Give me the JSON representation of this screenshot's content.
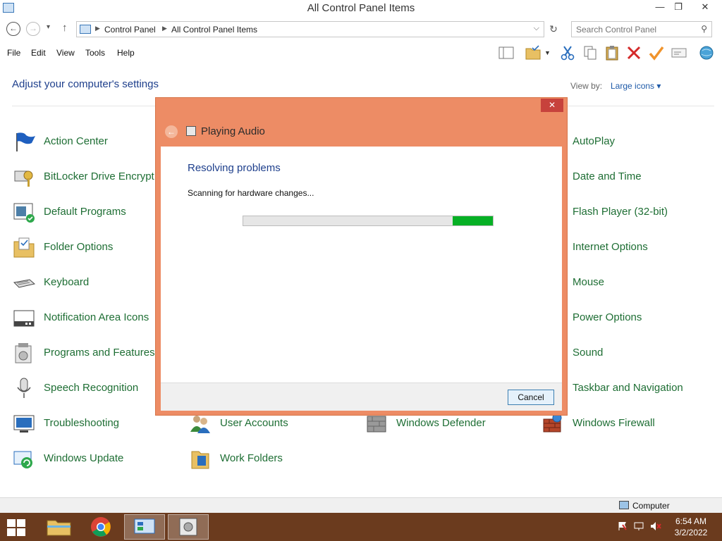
{
  "window": {
    "title": "All Control Panel Items",
    "minimize": "—",
    "maximize": "❐",
    "close": "✕"
  },
  "nav": {
    "back": "←",
    "forward": "→",
    "recent": "▾",
    "up": "↑",
    "breadcrumbs": [
      "Control Panel",
      "All Control Panel Items"
    ],
    "separator": "▶",
    "address_dropdown": "⌵",
    "refresh": "↻",
    "search_placeholder": "Search Control Panel",
    "search_icon": "⚲"
  },
  "menu": [
    "File",
    "Edit",
    "View",
    "Tools",
    "Help"
  ],
  "toolbar_icons": [
    "layout-icon",
    "folder-options-icon",
    "cut-icon",
    "copy-icon",
    "paste-icon",
    "delete-icon",
    "check-icon",
    "properties-icon",
    "globe-icon"
  ],
  "content": {
    "heading": "Adjust your computer's settings",
    "view_by_label": "View by:",
    "view_by_value": "Large icons ▾"
  },
  "items": [
    {
      "label": "Action Center",
      "icon": "flag-icon"
    },
    {
      "label": "BitLocker Drive Encrypt",
      "icon": "bitlocker-icon"
    },
    {
      "label": "Default Programs",
      "icon": "default-programs-icon"
    },
    {
      "label": "Folder Options",
      "icon": "folder-options-icon"
    },
    {
      "label": "Keyboard",
      "icon": "keyboard-icon"
    },
    {
      "label": "Notification Area Icons",
      "icon": "notification-icon"
    },
    {
      "label": "Programs and Features",
      "icon": "programs-icon"
    },
    {
      "label": "Speech Recognition",
      "icon": "microphone-icon"
    },
    {
      "label": "Troubleshooting",
      "icon": "troubleshooting-icon"
    },
    {
      "label": "Windows Update",
      "icon": "windows-update-icon"
    },
    {
      "label": "User Accounts",
      "icon": "users-icon"
    },
    {
      "label": "Work Folders",
      "icon": "work-folders-icon"
    },
    {
      "label": "Windows Defender",
      "icon": "defender-icon"
    },
    {
      "label": "AutoPlay",
      "icon": "autoplay-icon"
    },
    {
      "label": "Date and Time",
      "icon": "clock-icon"
    },
    {
      "label": "Flash Player (32-bit)",
      "icon": "flash-icon"
    },
    {
      "label": "Internet Options",
      "icon": "internet-icon"
    },
    {
      "label": "Mouse",
      "icon": "mouse-icon"
    },
    {
      "label": "Power Options",
      "icon": "power-icon"
    },
    {
      "label": "Sound",
      "icon": "sound-icon"
    },
    {
      "label": "Taskbar and Navigation",
      "icon": "taskbar-icon"
    },
    {
      "label": "Windows Firewall",
      "icon": "firewall-icon"
    }
  ],
  "dialog": {
    "title": "Playing Audio",
    "close": "✕",
    "back": "←",
    "heading": "Resolving problems",
    "status": "Scanning for hardware changes...",
    "progress_chunk_start": 0.84,
    "progress_chunk_end": 1.0,
    "cancel_label": "Cancel",
    "accent": "#ed8c65"
  },
  "statusbar": {
    "location": "Computer"
  },
  "taskbar": {
    "apps": [
      "file-explorer-icon",
      "chrome-icon",
      "control-panel-icon",
      "troubleshooter-icon"
    ],
    "time": "6:54 AM",
    "date": "3/2/2022",
    "color": "#6b3b1e"
  }
}
